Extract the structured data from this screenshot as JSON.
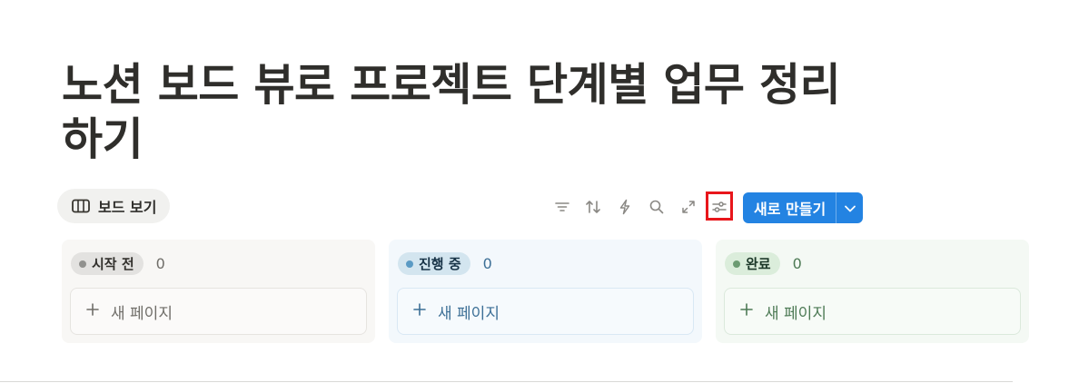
{
  "page": {
    "title": "노션 보드 뷰로 프로젝트 단계별 업무 정리하기"
  },
  "view_tab": {
    "label": "보드 보기",
    "icon": "board-icon"
  },
  "toolbar": {
    "icons": [
      "filter-icon",
      "sort-icon",
      "automation-icon",
      "search-icon",
      "expand-icon",
      "settings-sliders-icon"
    ],
    "new_button_label": "새로 만들기",
    "highlight_color": "#e8161b"
  },
  "columns": [
    {
      "status": "시작 전",
      "count": "0",
      "add_label": "새 페이지",
      "pill_bg": "#e3e2e0",
      "dot": "#91918e",
      "text": "#32302c",
      "count_color": "#6f6d68"
    },
    {
      "status": "진행 중",
      "count": "0",
      "add_label": "새 페이지",
      "pill_bg": "#d3e5ef",
      "dot": "#5a9ac4",
      "text": "#183347",
      "count_color": "#3c6f96"
    },
    {
      "status": "완료",
      "count": "0",
      "add_label": "새 페이지",
      "pill_bg": "#dbeddb",
      "dot": "#6c9b72",
      "text": "#1c3829",
      "count_color": "#4d7a55"
    }
  ],
  "colors": {
    "accent": "#2383e2"
  }
}
